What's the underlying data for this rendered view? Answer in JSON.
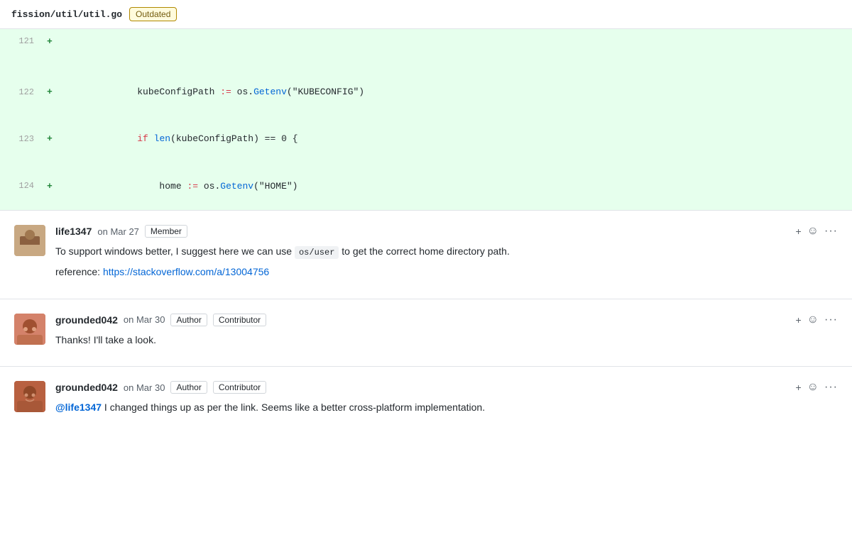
{
  "fileHeader": {
    "path": "fission/util/util.go",
    "outdatedLabel": "Outdated"
  },
  "diff": {
    "lines": [
      {
        "lineNum": "121",
        "plus": "+",
        "tokens": [
          {
            "text": "",
            "class": ""
          }
        ],
        "empty": true
      },
      {
        "lineNum": "",
        "plus": "",
        "tokens": [],
        "spacer": true
      },
      {
        "lineNum": "122",
        "plus": "+",
        "code": "        kubeConfigPath := os.Getenv(\"KUBECONFIG\")",
        "tokens": [
          {
            "text": "        kubeConfigPath ",
            "class": "kw-dark"
          },
          {
            "text": ":=",
            "class": "kw-op"
          },
          {
            "text": " os.",
            "class": "kw-dark"
          },
          {
            "text": "Getenv",
            "class": "kw-blue"
          },
          {
            "text": "(\"KUBECONFIG\")",
            "class": "kw-dark"
          }
        ]
      },
      {
        "lineNum": "123",
        "plus": "+",
        "tokens": [
          {
            "text": "        ",
            "class": ""
          },
          {
            "text": "if",
            "class": "kw-red"
          },
          {
            "text": " ",
            "class": ""
          },
          {
            "text": "len",
            "class": "kw-blue"
          },
          {
            "text": "(kubeConfigPath) == 0 {",
            "class": "kw-dark"
          }
        ]
      },
      {
        "lineNum": "124",
        "plus": "+",
        "tokens": [
          {
            "text": "            home ",
            "class": "kw-dark"
          },
          {
            "text": ":=",
            "class": "kw-op"
          },
          {
            "text": " os.",
            "class": "kw-dark"
          },
          {
            "text": "Getenv",
            "class": "kw-blue"
          },
          {
            "text": "(\"HOME\")",
            "class": "kw-dark"
          }
        ]
      }
    ]
  },
  "comments": [
    {
      "id": "comment1",
      "author": "life1347",
      "date": "on Mar 27",
      "badges": [
        "Member"
      ],
      "avatarType": "life1347",
      "paragraphs": [
        {
          "type": "text-with-code",
          "before": "To support windows better, I suggest here we can use ",
          "code": "os/user",
          "after": " to get the correct home directory path."
        },
        {
          "type": "text-with-link",
          "before": "reference: ",
          "linkText": "https://stackoverflow.com/a/13004756",
          "linkHref": "#"
        }
      ]
    },
    {
      "id": "comment2",
      "author": "grounded042",
      "date": "on Mar 30",
      "badges": [
        "Author",
        "Contributor"
      ],
      "avatarType": "grounded042",
      "paragraphs": [
        {
          "type": "plain",
          "text": "Thanks! I'll take a look."
        }
      ]
    },
    {
      "id": "comment3",
      "author": "grounded042",
      "date": "on Mar 30",
      "badges": [
        "Author",
        "Contributor"
      ],
      "avatarType": "grounded042b",
      "paragraphs": [
        {
          "type": "plain",
          "text": "@life1347 I changed things up as per the link. Seems like a better cross-platform implementation."
        }
      ]
    }
  ],
  "actions": {
    "emoji": "☺",
    "more": "···"
  }
}
